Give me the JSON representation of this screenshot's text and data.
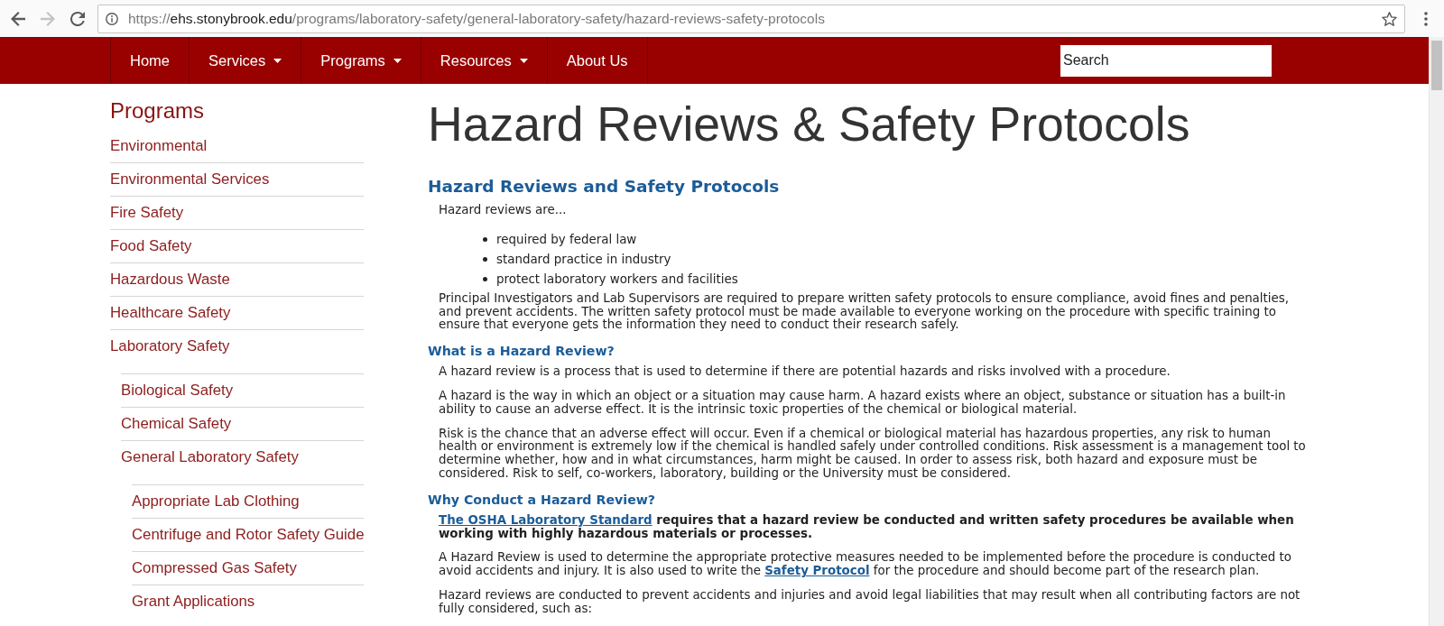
{
  "browser": {
    "nav_buttons": [
      {
        "kind": "back",
        "disabled": false
      },
      {
        "kind": "forward",
        "disabled": true
      },
      {
        "kind": "reload",
        "disabled": false
      }
    ],
    "url": {
      "scheme": "https://",
      "host": "ehs.stonybrook.edu",
      "path": "/programs/laboratory-safety/general-laboratory-safety/hazard-reviews-safety-protocols"
    }
  },
  "navbar": {
    "items": [
      {
        "label": "Home",
        "dropdown": false
      },
      {
        "label": "Services",
        "dropdown": true
      },
      {
        "label": "Programs",
        "dropdown": true
      },
      {
        "label": "Resources",
        "dropdown": true
      },
      {
        "label": "About Us",
        "dropdown": false
      }
    ],
    "search": {
      "placeholder": "Search"
    }
  },
  "sidebar": {
    "title": "Programs",
    "items": [
      {
        "label": "Environmental"
      },
      {
        "label": "Environmental Services"
      },
      {
        "label": "Fire Safety"
      },
      {
        "label": "Food Safety"
      },
      {
        "label": "Hazardous Waste"
      },
      {
        "label": "Healthcare Safety"
      },
      {
        "label": "Laboratory Safety",
        "children": [
          {
            "label": "Biological Safety"
          },
          {
            "label": "Chemical Safety"
          },
          {
            "label": "General Laboratory Safety",
            "children": [
              {
                "label": "Appropriate Lab Clothing"
              },
              {
                "label": "Centrifuge and Rotor Safety Guide"
              },
              {
                "label": "Compressed Gas Safety"
              },
              {
                "label": "Grant Applications"
              }
            ]
          }
        ]
      }
    ]
  },
  "content": {
    "title": "Hazard Reviews & Safety Protocols",
    "blocks": [
      {
        "kind": "section_heading",
        "text": "Hazard Reviews and Safety Protocols"
      },
      {
        "kind": "paragraph",
        "bold": false,
        "text": "Hazard reviews are..."
      },
      {
        "kind": "bullets",
        "items": [
          "required by federal law",
          "standard practice in industry",
          "protect laboratory workers and facilities"
        ]
      },
      {
        "kind": "paragraph",
        "bold": false,
        "text": "Principal Investigators and Lab Supervisors are required to prepare written safety protocols to ensure compliance, avoid fines and penalties, and prevent accidents. The written safety protocol must be made available to everyone working on the procedure with specific training to ensure that everyone gets the information they need to conduct their research safely."
      },
      {
        "kind": "subheading",
        "text": "What is a Hazard Review?"
      },
      {
        "kind": "paragraph",
        "bold": false,
        "text": "A hazard review is a process that is used to determine if there are potential hazards and risks involved with a procedure."
      },
      {
        "kind": "paragraph",
        "bold": false,
        "text": "A hazard is the way in which an object or a situation may cause harm. A hazard exists where an object, substance or situation has a built-in ability to cause an adverse effect. It is the intrinsic toxic properties of the chemical or biological material."
      },
      {
        "kind": "paragraph",
        "bold": false,
        "text": "Risk is the chance that an adverse effect will occur. Even if a chemical or biological material has hazardous properties, any risk to human health or environment is extremely low if the chemical is handled safely under controlled conditions. Risk assessment is a management tool to determine whether, how and in what circumstances, harm might be caused. In order to assess risk, both hazard and exposure must be considered. Risk to self, co-workers, laboratory, building or the University must be considered."
      },
      {
        "kind": "subheading",
        "text": "Why Conduct a Hazard Review?"
      },
      {
        "kind": "paragraph",
        "bold": true,
        "parts": [
          {
            "kind": "link",
            "text": "The OSHA Laboratory Standard"
          },
          {
            "kind": "text",
            "text": " requires that a hazard review be conducted and written safety procedures be available when working with highly hazardous materials or processes."
          }
        ]
      },
      {
        "kind": "paragraph",
        "bold": false,
        "parts": [
          {
            "kind": "text",
            "text": "A Hazard Review is used to determine the appropriate protective measures needed to be implemented before the procedure is conducted to avoid accidents and injury. It is also used to write the "
          },
          {
            "kind": "link",
            "text": "Safety Protocol"
          },
          {
            "kind": "text",
            "text": " for the procedure and should become part of the research plan."
          }
        ]
      },
      {
        "kind": "paragraph",
        "bold": false,
        "text": "Hazard reviews are conducted to prevent accidents and injuries and avoid legal liabilities that may result when all contributing factors are not fully considered, such as:"
      }
    ]
  }
}
